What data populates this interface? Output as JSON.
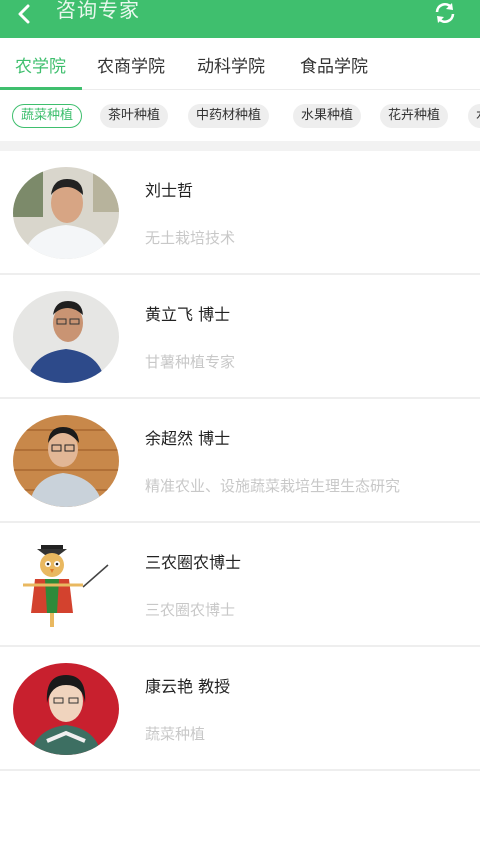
{
  "header": {
    "title": "咨询专家",
    "back_icon": "back-arrow-icon",
    "refresh_icon": "refresh-icon"
  },
  "tabs": [
    {
      "label": "农学院",
      "active": true
    },
    {
      "label": "农商学院"
    },
    {
      "label": "动科学院"
    },
    {
      "label": "食品学院"
    }
  ],
  "chips": [
    {
      "label": "蔬菜种植",
      "active": true
    },
    {
      "label": "茶叶种植"
    },
    {
      "label": "中药材种植"
    },
    {
      "label": "水果种植"
    },
    {
      "label": "花卉种植"
    },
    {
      "label": "水"
    }
  ],
  "experts": [
    {
      "name": "刘士哲",
      "description": "无土栽培技术"
    },
    {
      "name": "黄立飞 博士",
      "description": "甘薯种植专家"
    },
    {
      "name": "余超然 博士",
      "description": "精准农业、设施蔬菜栽培生理生态研究"
    },
    {
      "name": "三农圈农博士",
      "description": "三农圈农博士"
    },
    {
      "name": "康云艳 教授",
      "description": "蔬菜种植"
    }
  ],
  "colors": {
    "accent": "#3fbf6e"
  }
}
